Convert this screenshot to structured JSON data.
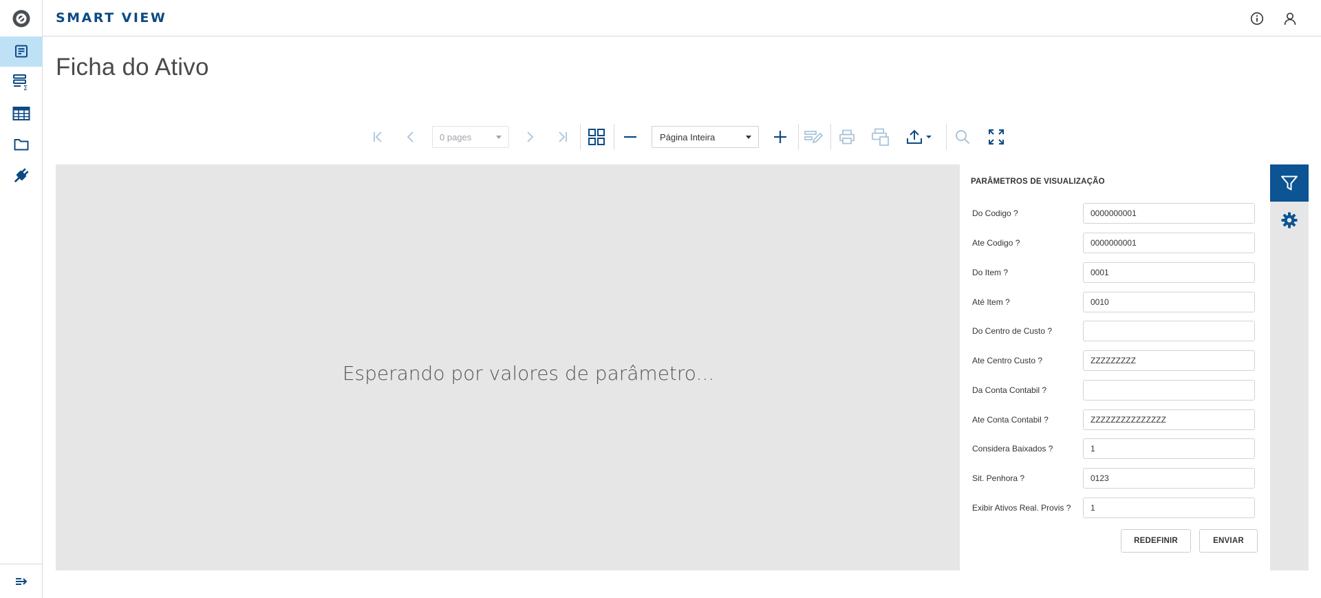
{
  "app": {
    "brand": "SMART VIEW"
  },
  "page": {
    "title": "Ficha do Ativo"
  },
  "nav": {
    "items": [
      {
        "name": "reports",
        "icon": "report-icon",
        "active": true
      },
      {
        "name": "analysis",
        "icon": "analysis-sigma-icon",
        "active": false
      },
      {
        "name": "grids",
        "icon": "table-icon",
        "active": false
      },
      {
        "name": "files",
        "icon": "folder-icon",
        "active": false
      },
      {
        "name": "integrations",
        "icon": "plug-icon",
        "active": false
      }
    ]
  },
  "toolbar": {
    "pages_value": "0 pages",
    "zoom_value": "Página Inteira"
  },
  "viewer": {
    "message": "Esperando por valores de parâmetro..."
  },
  "params": {
    "title": "PARÂMETROS DE VISUALIZAÇÃO",
    "fields": [
      {
        "label": "Do Codigo ?",
        "value": "0000000001"
      },
      {
        "label": "Ate Codigo ?",
        "value": "0000000001"
      },
      {
        "label": "Do Item ?",
        "value": "0001"
      },
      {
        "label": "Até Item ?",
        "value": "0010"
      },
      {
        "label": "Do Centro de Custo ?",
        "value": ""
      },
      {
        "label": "Ate Centro Custo ?",
        "value": "ZZZZZZZZZ"
      },
      {
        "label": "Da Conta Contabil ?",
        "value": ""
      },
      {
        "label": "Ate Conta Contabil ?",
        "value": "ZZZZZZZZZZZZZZZ"
      },
      {
        "label": "Considera Baixados ?",
        "value": "1"
      },
      {
        "label": "Sit. Penhora ?",
        "value": "0123"
      },
      {
        "label": "Exibir Ativos Real. Provis ?",
        "value": "1"
      }
    ],
    "reset_label": "REDEFINIR",
    "submit_label": "ENVIAR"
  },
  "colors": {
    "accent": "#0c5493",
    "brand": "#0c4a82",
    "active_nav": "#bfe1f6",
    "viewer_bg": "#e6e6e6"
  }
}
